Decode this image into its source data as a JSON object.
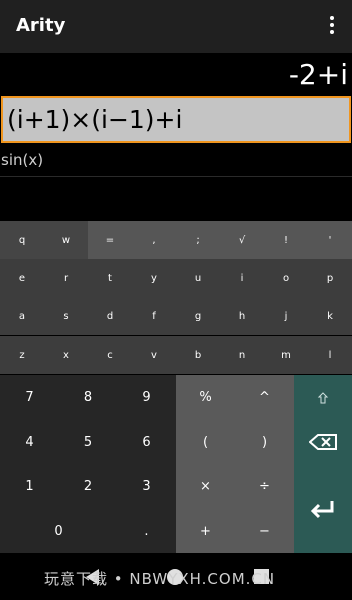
{
  "app": {
    "title": "Arity",
    "menu_icon": "more-vert-icon"
  },
  "display": {
    "result": "-2+i",
    "input": "(i+1)×(i−1)+i",
    "history": [
      "sin(x)"
    ]
  },
  "keyboard": {
    "row1": [
      "q",
      "w",
      "=",
      ",",
      ";",
      "√",
      "!",
      "'"
    ],
    "row2": [
      "e",
      "r",
      "t",
      "y",
      "u",
      "i",
      "o",
      "p"
    ],
    "row3": [
      "a",
      "s",
      "d",
      "f",
      "g",
      "h",
      "j",
      "k"
    ],
    "row4": [
      "z",
      "x",
      "c",
      "v",
      "b",
      "n",
      "m",
      "l"
    ],
    "numpad": [
      [
        "7",
        "8",
        "9"
      ],
      [
        "4",
        "5",
        "6"
      ],
      [
        "1",
        "2",
        "3"
      ],
      [
        "0",
        "."
      ]
    ],
    "ops": [
      [
        "%",
        "^"
      ],
      [
        "(",
        ")"
      ],
      [
        "×",
        "÷"
      ],
      [
        "+",
        "−"
      ]
    ],
    "controls": [
      "shift-icon",
      "backspace-icon",
      "enter-icon"
    ]
  },
  "watermark": "玩意下载 • NBWYXH.COM.CN",
  "colors": {
    "accent": "#f0951e",
    "control_pad": "#2c5a55",
    "op_pad": "#5a5a5a"
  }
}
